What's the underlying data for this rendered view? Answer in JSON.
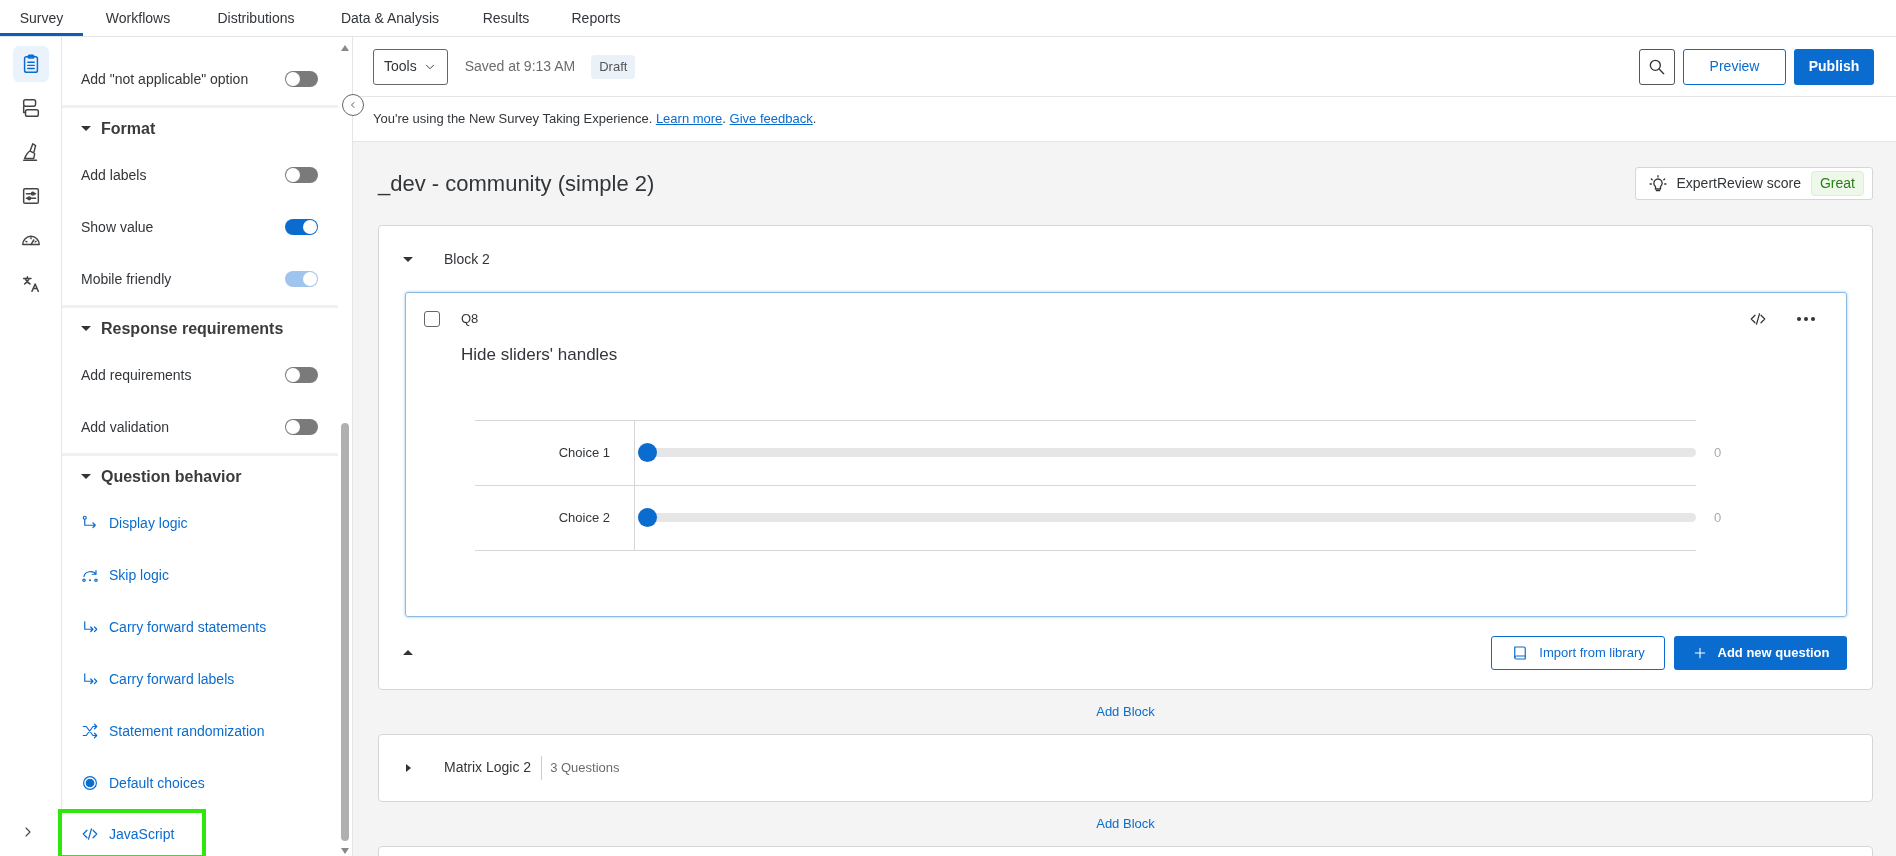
{
  "top_tabs": [
    {
      "label": "Survey",
      "selected": true
    },
    {
      "label": "Workflows",
      "selected": false
    },
    {
      "label": "Distributions",
      "selected": false
    },
    {
      "label": "Data & Analysis",
      "selected": false
    },
    {
      "label": "Results",
      "selected": false
    },
    {
      "label": "Reports",
      "selected": false
    }
  ],
  "rail": [
    {
      "kind": "survey",
      "selected": true
    },
    {
      "kind": "flow",
      "selected": false
    },
    {
      "kind": "look",
      "selected": false
    },
    {
      "kind": "options",
      "selected": false
    },
    {
      "kind": "gauge",
      "selected": false
    },
    {
      "kind": "translate",
      "selected": false
    }
  ],
  "sidebar": {
    "sections": [
      {
        "items": [
          {
            "kind": "toggle",
            "label": "Add \"not applicable\" option",
            "on": false,
            "disabled": false
          }
        ]
      },
      {
        "title": "Format",
        "expanded": true,
        "items": [
          {
            "kind": "toggle",
            "label": "Add labels",
            "on": false,
            "disabled": false
          },
          {
            "kind": "toggle",
            "label": "Show value",
            "on": true,
            "disabled": false
          },
          {
            "kind": "toggle",
            "label": "Mobile friendly",
            "on": true,
            "disabled": true
          }
        ]
      },
      {
        "title": "Response requirements",
        "expanded": true,
        "items": [
          {
            "kind": "toggle",
            "label": "Add requirements",
            "on": false,
            "disabled": false
          },
          {
            "kind": "toggle",
            "label": "Add validation",
            "on": false,
            "disabled": false
          }
        ]
      },
      {
        "title": "Question behavior",
        "expanded": true,
        "items": [
          {
            "kind": "display",
            "label": "Display logic",
            "highlighted": false
          },
          {
            "kind": "skip",
            "label": "Skip logic",
            "highlighted": false
          },
          {
            "kind": "carry",
            "label": "Carry forward statements",
            "highlighted": false
          },
          {
            "kind": "carry",
            "label": "Carry forward labels",
            "highlighted": false
          },
          {
            "kind": "shuffle",
            "label": "Statement randomization",
            "highlighted": false
          },
          {
            "kind": "radio",
            "label": "Default choices",
            "highlighted": false
          },
          {
            "kind": "code",
            "label": "JavaScript",
            "highlighted": true
          }
        ]
      }
    ]
  },
  "toolbar": {
    "tools": "Tools",
    "saved": "Saved at 9:13 AM",
    "status": "Draft",
    "preview": "Preview",
    "publish": "Publish"
  },
  "banner": [
    {
      "text": "You're using the New Survey Taking Experience. "
    },
    {
      "link": "Learn more"
    },
    {
      "text": ". "
    },
    {
      "link": "Give feedback"
    },
    {
      "text": "."
    }
  ],
  "survey_title": "_dev - community (simple 2)",
  "expert_review": {
    "label": "ExpertReview score",
    "score": "Great"
  },
  "blocks": [
    {
      "title": "Block 2",
      "expanded": true,
      "questions": [
        {
          "number": "Q8",
          "text": "Hide sliders' handles",
          "checked": false,
          "selected": true,
          "statements": [
            {
              "label": "Choice 1",
              "level": 0,
              "reading": "0"
            },
            {
              "label": "Choice 2",
              "level": 0,
              "reading": "0"
            }
          ]
        }
      ],
      "import": "Import from library",
      "add_question": "Add new question",
      "add_block": "Add Block"
    },
    {
      "title": "Matrix Logic 2",
      "expanded": false,
      "count": "3 Questions",
      "add_block": "Add Block"
    }
  ]
}
